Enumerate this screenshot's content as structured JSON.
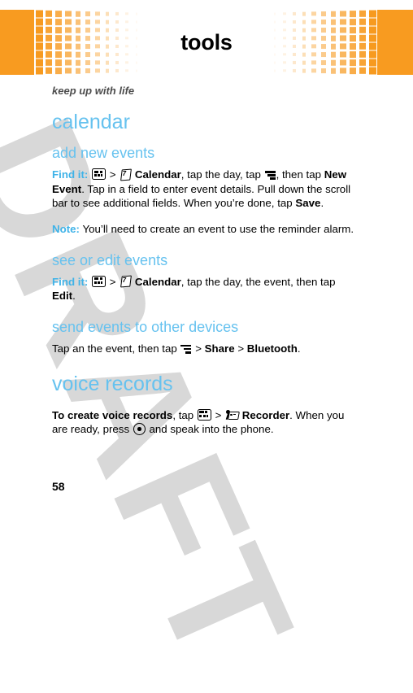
{
  "header": {
    "title": "tools",
    "accent_color": "#f79a1f"
  },
  "watermark": {
    "text": "DRAFT",
    "color": "#d8d8d8"
  },
  "content": {
    "kicker": "keep up with life",
    "chapter_calendar": "calendar",
    "section_add_new_events": "add new events",
    "find_it_label": "Find it:",
    "note_label": "Note:",
    "icons": {
      "main_menu": "menu-grid-icon",
      "calendar": "calendar-icon",
      "options": "menu-bars-icon",
      "recorder": "recorder-icon",
      "center_key": "center-key-icon"
    },
    "add_new_events_para": {
      "sep1": ">",
      "app": "Calendar",
      "text1": ", tap the day, tap",
      "text2": ", then tap",
      "bold1": "New Event",
      "text3": ". Tap in a field to enter event details. Pull down the scroll bar to see additional fields. When you’re done, tap",
      "bold2": "Save",
      "text4": "."
    },
    "note_para": "You’ll need to create an event to use the reminder alarm.",
    "section_see_or_edit_events": "see or edit events",
    "see_or_edit_para": {
      "sep1": ">",
      "app": "Calendar",
      "text1": ", tap the day, the event, then tap",
      "bold1": "Edit",
      "text2": "."
    },
    "section_send_events": "send events to other devices",
    "send_events_para": {
      "text1": "Tap an the event, then tap",
      "sep1": ">",
      "bold1": "Share",
      "sep2": ">",
      "bold2": "Bluetooth",
      "text2": "."
    },
    "chapter_voice_records": "voice records",
    "voice_records_para": {
      "bold1": "To create voice records",
      "text1": ", tap",
      "sep1": ">",
      "bold2": "Recorder",
      "text2": ". When you are ready, press",
      "text3": "and speak into the phone."
    }
  },
  "footer": {
    "page_number": "58"
  }
}
